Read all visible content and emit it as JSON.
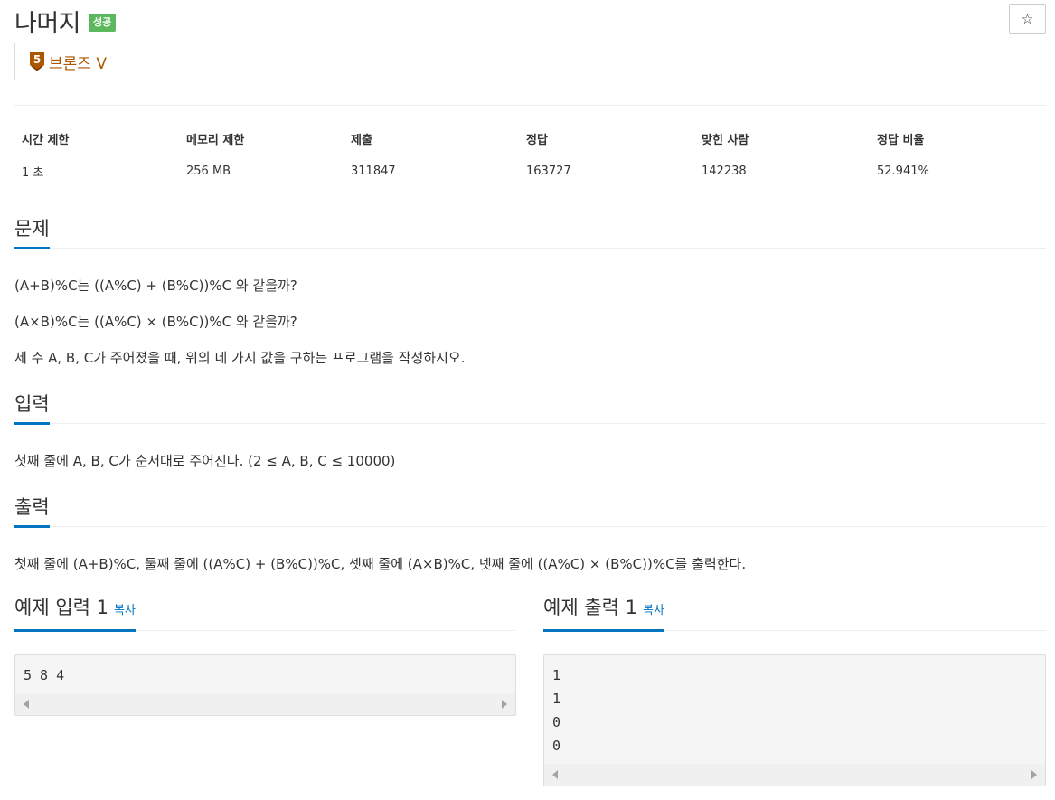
{
  "problem": {
    "title": "나머지",
    "result_badge": "성공",
    "star_icon": "☆",
    "tier": {
      "level": "5",
      "label": "브론즈 V",
      "color": "#ad5600"
    }
  },
  "info_table": {
    "headers": [
      "시간 제한",
      "메모리 제한",
      "제출",
      "정답",
      "맞힌 사람",
      "정답 비율"
    ],
    "values": [
      "1 초",
      "256 MB",
      "311847",
      "163727",
      "142238",
      "52.941%"
    ]
  },
  "sections": {
    "description": {
      "heading": "문제",
      "lines": [
        "(A+B)%C는 ((A%C) + (B%C))%C 와 같을까?",
        "(A×B)%C는 ((A%C) × (B%C))%C 와 같을까?",
        "세 수 A, B, C가 주어졌을 때, 위의 네 가지 값을 구하는 프로그램을 작성하시오."
      ]
    },
    "input": {
      "heading": "입력",
      "text": "첫째 줄에 A, B, C가 순서대로 주어진다. (2 ≤ A, B, C ≤ 10000)"
    },
    "output": {
      "heading": "출력",
      "text": "첫째 줄에 (A+B)%C, 둘째 줄에 ((A%C) + (B%C))%C, 셋째 줄에 (A×B)%C, 넷째 줄에 ((A%C) × (B%C))%C를 출력한다."
    }
  },
  "samples": {
    "input": {
      "heading": "예제 입력 1",
      "copy_label": "복사",
      "content": "5 8 4"
    },
    "output": {
      "heading": "예제 출력 1",
      "copy_label": "복사",
      "content": "1\n1\n0\n0"
    }
  },
  "colors": {
    "accent": "#0076c0",
    "success_badge": "#5cb85c",
    "bronze": "#ad5600"
  }
}
